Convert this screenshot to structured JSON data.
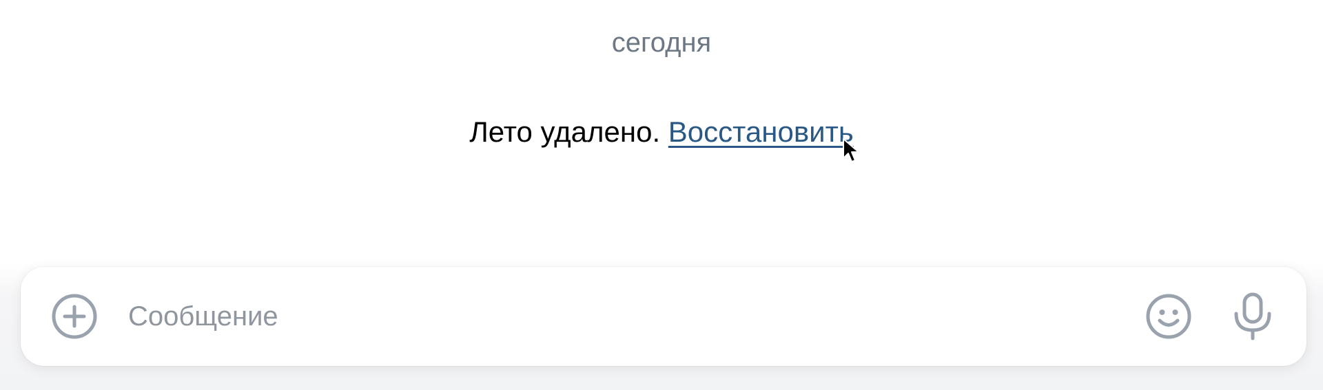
{
  "chat": {
    "date_separator": "сегодня",
    "notice": {
      "text": "Лето удалено.",
      "restore_link": "Восстановить"
    }
  },
  "composer": {
    "input_value": "",
    "placeholder": "Сообщение",
    "icons": {
      "attach": "plus-circle-icon",
      "emoji": "smile-icon",
      "voice": "microphone-icon"
    }
  },
  "colors": {
    "link": "#2a5885",
    "muted_text": "#6d7885",
    "icon": "#99a2ad"
  }
}
